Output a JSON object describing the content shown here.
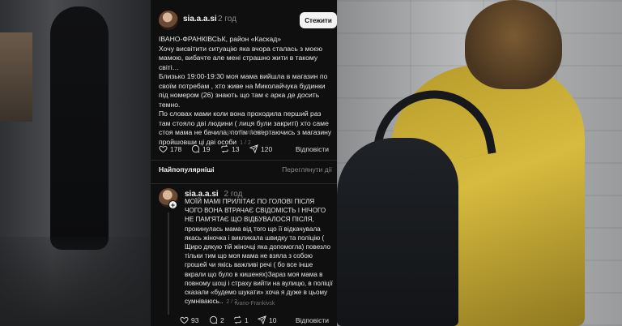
{
  "post": {
    "username": "sia.a.a.si",
    "time": "2 год",
    "follow_label": "Стежити",
    "text": "ІВАНО-ФРАНКІВСЬК, район «Каскад»\nХочу висвітити ситуацію яка вчора сталась з моєю мамою, вибачте але мені страшно жити в такому світі…\nБлизько 19:00-19:30 моя мама вийшла в магазин по своїм потребам , хто живе на Миколайчука будинки під номером (26) знають що там є арка де досить темно.\nПо словах мами коли вона проходила перший раз там стояло дві людини ( лиця були закриті) хто саме стоя мама не бачила, потім повертаючись з магазину пройшовши ці дві особи",
    "page_badge": "1 / 2",
    "location": "Ivano-Frankivsk",
    "likes": "178",
    "comments": "19",
    "reposts": "13",
    "shares": "120",
    "translate_label": "Відповісти"
  },
  "sort": {
    "label": "Найпопулярніші",
    "see_activity": "Переглянути дії"
  },
  "reply": {
    "username": "sia.a.a.si",
    "time": "2 год",
    "text": "МОЇЙ МАМІ ПРИЛІТАЄ ПО ГОЛОВІ ПІСЛЯ ЧОГО ВОНА ВТРАЧАЄ СВІДОМІСТЬ І НІЧОГО НЕ ПАМ'ЯТАЄ ЩО ВІДБУВАЛОСЯ ПІСЛЯ, прокинулась мама від того що її відкачувала якась жіночка і викликала швидку та поліцію ( Щиро дякую тій жіночці яка допомогла) повезло тільки тим що моя мама не взяла з собою грошей чи якісь важливі речі ( бо все інше вкрали що було в кишенях)Зараз моя мама в повному шоці і страху вийти на вулицю, в поліції сказали «будемо шукати» хоча я дуже в цьому сумніваюсь..",
    "page_badge": "2 / 2",
    "location": "Ivano-Frankivsk",
    "likes": "93",
    "comments": "2",
    "reposts": "1",
    "shares": "10",
    "translate_label": "Відповісти"
  },
  "colors": {
    "background": "#0f0f10",
    "text": "#ececec",
    "muted": "#8a8a8a"
  },
  "icons": [
    "heart-icon",
    "comment-icon",
    "repost-icon",
    "send-icon",
    "chevron-down-icon",
    "plus-icon"
  ]
}
